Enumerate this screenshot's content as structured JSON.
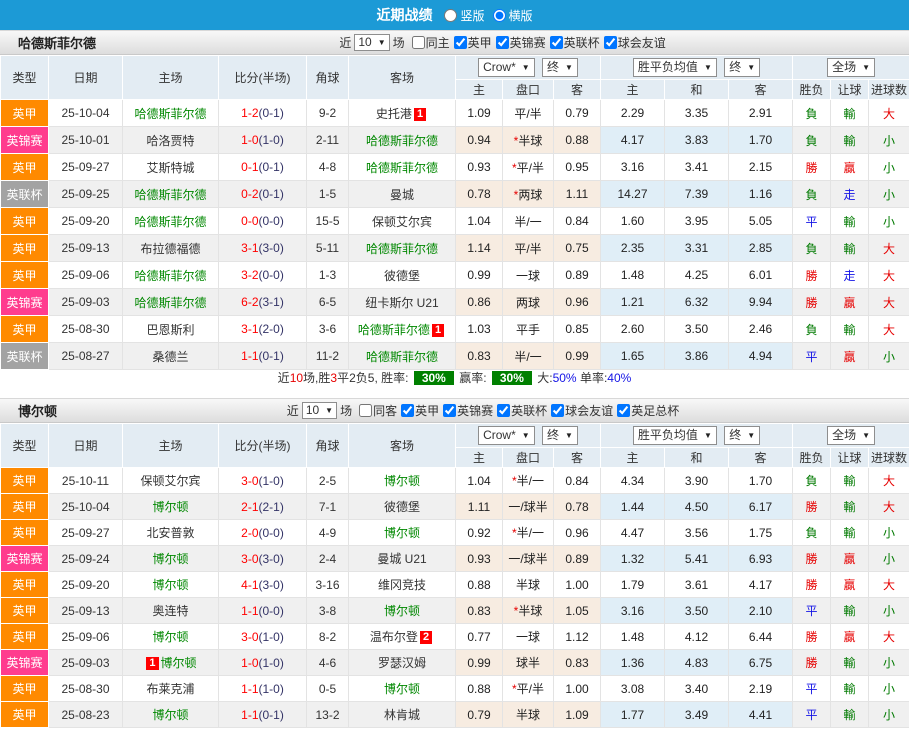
{
  "topbar": {
    "title": "近期战绩",
    "radios": [
      {
        "label": "竖版",
        "checked": false
      },
      {
        "label": "横版",
        "checked": true
      }
    ]
  },
  "columns": {
    "type": "类型",
    "date": "日期",
    "home": "主场",
    "score": "比分(半场)",
    "corner": "角球",
    "away": "客场",
    "odds_home": "主",
    "handicap": "盘口",
    "odds_away": "客",
    "avg_home": "主",
    "avg_draw": "和",
    "avg_away": "客",
    "outcome": "胜负",
    "letgoal": "让球",
    "goals": "进球数"
  },
  "dropdowns": {
    "bookmaker": "Crow*",
    "final_a": "终",
    "avg": "胜平负均值",
    "final_b": "终",
    "scope": "全场",
    "caret": "▼"
  },
  "colors": {
    "topbar_blue": "#1C9AD6",
    "league_yingjia": "#FF8A00",
    "league_yingjinsai": "#FF3C8E",
    "league_yinglianbei": "#A3A3A3",
    "subject_team_green": "#008800",
    "win_red": "#E60000",
    "draw_blue": "#1414E6",
    "loss_green": "#007A00",
    "rate_badge_green": "#008000",
    "score_red": "#FF0000"
  },
  "sections": [
    {
      "team": "哈德斯菲尔德",
      "filter": {
        "near": "近",
        "count": "10",
        "unit": "场",
        "checks": [
          {
            "label": "同主",
            "checked": false
          },
          {
            "label": "英甲",
            "checked": true
          },
          {
            "label": "英锦赛",
            "checked": true
          },
          {
            "label": "英联杯",
            "checked": true
          },
          {
            "label": "球会友谊",
            "checked": true
          }
        ]
      },
      "rows": [
        {
          "lg": "jia",
          "league": "英甲",
          "date": "25-10-04",
          "home": {
            "name": "哈德斯菲尔德",
            "green": true
          },
          "ft": "1-2",
          "ht": "(0-1)",
          "corner": "9-2",
          "away": {
            "name": "史托港",
            "badge": "1"
          },
          "o": [
            "1.09",
            "平/半",
            "0.79"
          ],
          "a": [
            "2.29",
            "3.35",
            "2.91"
          ],
          "r": [
            [
              "負",
              "g"
            ],
            [
              "輸",
              "g"
            ],
            [
              "大",
              "r"
            ]
          ]
        },
        {
          "lg": "jin",
          "league": "英锦赛",
          "date": "25-10-01",
          "home": {
            "name": "哈洛贾特"
          },
          "ft": "1-0",
          "ht": "(1-0)",
          "corner": "2-11",
          "away": {
            "name": "哈德斯菲尔德",
            "green": true
          },
          "o": [
            "0.94",
            "*半球",
            "0.88"
          ],
          "a": [
            "4.17",
            "3.83",
            "1.70"
          ],
          "r": [
            [
              "負",
              "g"
            ],
            [
              "輸",
              "g"
            ],
            [
              "小",
              "g"
            ]
          ]
        },
        {
          "lg": "jia",
          "league": "英甲",
          "date": "25-09-27",
          "home": {
            "name": "艾斯特城"
          },
          "ft": "0-1",
          "ht": "(0-1)",
          "corner": "4-8",
          "away": {
            "name": "哈德斯菲尔德",
            "green": true
          },
          "o": [
            "0.93",
            "*平/半",
            "0.95"
          ],
          "a": [
            "3.16",
            "3.41",
            "2.15"
          ],
          "r": [
            [
              "勝",
              "r"
            ],
            [
              "贏",
              "r"
            ],
            [
              "小",
              "g"
            ]
          ]
        },
        {
          "lg": "lian",
          "league": "英联杯",
          "date": "25-09-25",
          "home": {
            "name": "哈德斯菲尔德",
            "green": true
          },
          "ft": "0-2",
          "ht": "(0-1)",
          "corner": "1-5",
          "away": {
            "name": "曼城"
          },
          "o": [
            "0.78",
            "*两球",
            "1.11"
          ],
          "a": [
            "14.27",
            "7.39",
            "1.16"
          ],
          "r": [
            [
              "負",
              "g"
            ],
            [
              "走",
              "b"
            ],
            [
              "小",
              "g"
            ]
          ]
        },
        {
          "lg": "jia",
          "league": "英甲",
          "date": "25-09-20",
          "home": {
            "name": "哈德斯菲尔德",
            "green": true
          },
          "ft": "0-0",
          "ht": "(0-0)",
          "corner": "15-5",
          "away": {
            "name": "保顿艾尔宾"
          },
          "o": [
            "1.04",
            "半/一",
            "0.84"
          ],
          "a": [
            "1.60",
            "3.95",
            "5.05"
          ],
          "r": [
            [
              "平",
              "b"
            ],
            [
              "輸",
              "g"
            ],
            [
              "小",
              "g"
            ]
          ]
        },
        {
          "lg": "jia",
          "league": "英甲",
          "date": "25-09-13",
          "home": {
            "name": "布拉德福德"
          },
          "ft": "3-1",
          "ht": "(3-0)",
          "corner": "5-11",
          "away": {
            "name": "哈德斯菲尔德",
            "green": true
          },
          "o": [
            "1.14",
            "平/半",
            "0.75"
          ],
          "a": [
            "2.35",
            "3.31",
            "2.85"
          ],
          "r": [
            [
              "負",
              "g"
            ],
            [
              "輸",
              "g"
            ],
            [
              "大",
              "r"
            ]
          ]
        },
        {
          "lg": "jia",
          "league": "英甲",
          "date": "25-09-06",
          "home": {
            "name": "哈德斯菲尔德",
            "green": true
          },
          "ft": "3-2",
          "ht": "(0-0)",
          "corner": "1-3",
          "away": {
            "name": "彼德堡"
          },
          "o": [
            "0.99",
            "一球",
            "0.89"
          ],
          "a": [
            "1.48",
            "4.25",
            "6.01"
          ],
          "r": [
            [
              "勝",
              "r"
            ],
            [
              "走",
              "b"
            ],
            [
              "大",
              "r"
            ]
          ]
        },
        {
          "lg": "jin",
          "league": "英锦赛",
          "date": "25-09-03",
          "home": {
            "name": "哈德斯菲尔德",
            "green": true
          },
          "ft": "6-2",
          "ht": "(3-1)",
          "corner": "6-5",
          "away": {
            "name": "纽卡斯尔 U21"
          },
          "o": [
            "0.86",
            "两球",
            "0.96"
          ],
          "a": [
            "1.21",
            "6.32",
            "9.94"
          ],
          "r": [
            [
              "勝",
              "r"
            ],
            [
              "贏",
              "r"
            ],
            [
              "大",
              "r"
            ]
          ]
        },
        {
          "lg": "jia",
          "league": "英甲",
          "date": "25-08-30",
          "home": {
            "name": "巴恩斯利"
          },
          "ft": "3-1",
          "ht": "(2-0)",
          "corner": "3-6",
          "away": {
            "name": "哈德斯菲尔德",
            "green": true,
            "badge": "1"
          },
          "o": [
            "1.03",
            "平手",
            "0.85"
          ],
          "a": [
            "2.60",
            "3.50",
            "2.46"
          ],
          "r": [
            [
              "負",
              "g"
            ],
            [
              "輸",
              "g"
            ],
            [
              "大",
              "r"
            ]
          ]
        },
        {
          "lg": "lian",
          "league": "英联杯",
          "date": "25-08-27",
          "home": {
            "name": "桑德兰"
          },
          "ft": "1-1",
          "ht": "(0-1)",
          "corner": "11-2",
          "away": {
            "name": "哈德斯菲尔德",
            "green": true
          },
          "o": [
            "0.83",
            "半/一",
            "0.99"
          ],
          "a": [
            "1.65",
            "3.86",
            "4.94"
          ],
          "r": [
            [
              "平",
              "b"
            ],
            [
              "贏",
              "r"
            ],
            [
              "小",
              "g"
            ]
          ]
        }
      ],
      "summary": [
        {
          "t": "近"
        },
        {
          "t": "10",
          "c": "r"
        },
        {
          "t": "场,胜"
        },
        {
          "t": "3",
          "c": "r"
        },
        {
          "t": "平"
        },
        {
          "t": "2"
        },
        {
          "t": "负"
        },
        {
          "t": "5"
        },
        {
          "t": ", 胜率: "
        },
        {
          "t": "30%",
          "badge": true
        },
        {
          "t": " 赢率: "
        },
        {
          "t": "30%",
          "badge": true
        },
        {
          "t": " 大:"
        },
        {
          "t": "50%",
          "c": "b"
        },
        {
          "t": " 单率:"
        },
        {
          "t": "40%",
          "c": "b"
        }
      ]
    },
    {
      "team": "博尔顿",
      "filter": {
        "near": "近",
        "count": "10",
        "unit": "场",
        "checks": [
          {
            "label": "同客",
            "checked": false
          },
          {
            "label": "英甲",
            "checked": true
          },
          {
            "label": "英锦赛",
            "checked": true
          },
          {
            "label": "英联杯",
            "checked": true
          },
          {
            "label": "球会友谊",
            "checked": true
          },
          {
            "label": "英足总杯",
            "checked": true
          }
        ]
      },
      "rows": [
        {
          "lg": "jia",
          "league": "英甲",
          "date": "25-10-11",
          "home": {
            "name": "保顿艾尔宾"
          },
          "ft": "3-0",
          "ht": "(1-0)",
          "corner": "2-5",
          "away": {
            "name": "博尔顿",
            "green": true
          },
          "o": [
            "1.04",
            "*半/一",
            "0.84"
          ],
          "a": [
            "4.34",
            "3.90",
            "1.70"
          ],
          "r": [
            [
              "負",
              "g"
            ],
            [
              "輸",
              "g"
            ],
            [
              "大",
              "r"
            ]
          ]
        },
        {
          "lg": "jia",
          "league": "英甲",
          "date": "25-10-04",
          "home": {
            "name": "博尔顿",
            "green": true
          },
          "ft": "2-1",
          "ht": "(2-1)",
          "corner": "7-1",
          "away": {
            "name": "彼德堡"
          },
          "o": [
            "1.11",
            "一/球半",
            "0.78"
          ],
          "a": [
            "1.44",
            "4.50",
            "6.17"
          ],
          "r": [
            [
              "勝",
              "r"
            ],
            [
              "輸",
              "g"
            ],
            [
              "大",
              "r"
            ]
          ]
        },
        {
          "lg": "jia",
          "league": "英甲",
          "date": "25-09-27",
          "home": {
            "name": "北安普敦"
          },
          "ft": "2-0",
          "ht": "(0-0)",
          "corner": "4-9",
          "away": {
            "name": "博尔顿",
            "green": true
          },
          "o": [
            "0.92",
            "*半/一",
            "0.96"
          ],
          "a": [
            "4.47",
            "3.56",
            "1.75"
          ],
          "r": [
            [
              "負",
              "g"
            ],
            [
              "輸",
              "g"
            ],
            [
              "小",
              "g"
            ]
          ]
        },
        {
          "lg": "jin",
          "league": "英锦赛",
          "date": "25-09-24",
          "home": {
            "name": "博尔顿",
            "green": true
          },
          "ft": "3-0",
          "ht": "(3-0)",
          "corner": "2-4",
          "away": {
            "name": "曼城 U21"
          },
          "o": [
            "0.93",
            "一/球半",
            "0.89"
          ],
          "a": [
            "1.32",
            "5.41",
            "6.93"
          ],
          "r": [
            [
              "勝",
              "r"
            ],
            [
              "贏",
              "r"
            ],
            [
              "小",
              "g"
            ]
          ]
        },
        {
          "lg": "jia",
          "league": "英甲",
          "date": "25-09-20",
          "home": {
            "name": "博尔顿",
            "green": true
          },
          "ft": "4-1",
          "ht": "(3-0)",
          "corner": "3-16",
          "away": {
            "name": "维冈竞技"
          },
          "o": [
            "0.88",
            "半球",
            "1.00"
          ],
          "a": [
            "1.79",
            "3.61",
            "4.17"
          ],
          "r": [
            [
              "勝",
              "r"
            ],
            [
              "贏",
              "r"
            ],
            [
              "大",
              "r"
            ]
          ]
        },
        {
          "lg": "jia",
          "league": "英甲",
          "date": "25-09-13",
          "home": {
            "name": "奥连特"
          },
          "ft": "1-1",
          "ht": "(0-0)",
          "corner": "3-8",
          "away": {
            "name": "博尔顿",
            "green": true
          },
          "o": [
            "0.83",
            "*半球",
            "1.05"
          ],
          "a": [
            "3.16",
            "3.50",
            "2.10"
          ],
          "r": [
            [
              "平",
              "b"
            ],
            [
              "輸",
              "g"
            ],
            [
              "小",
              "g"
            ]
          ]
        },
        {
          "lg": "jia",
          "league": "英甲",
          "date": "25-09-06",
          "home": {
            "name": "博尔顿",
            "green": true
          },
          "ft": "3-0",
          "ht": "(1-0)",
          "corner": "8-2",
          "away": {
            "name": "温布尔登",
            "badge": "2"
          },
          "o": [
            "0.77",
            "一球",
            "1.12"
          ],
          "a": [
            "1.48",
            "4.12",
            "6.44"
          ],
          "r": [
            [
              "勝",
              "r"
            ],
            [
              "贏",
              "r"
            ],
            [
              "大",
              "r"
            ]
          ]
        },
        {
          "lg": "jin",
          "league": "英锦赛",
          "date": "25-09-03",
          "home": {
            "name": "博尔顿",
            "green": true,
            "badge": "1",
            "pos": "before"
          },
          "ft": "1-0",
          "ht": "(1-0)",
          "corner": "4-6",
          "away": {
            "name": "罗瑟汉姆"
          },
          "o": [
            "0.99",
            "球半",
            "0.83"
          ],
          "a": [
            "1.36",
            "4.83",
            "6.75"
          ],
          "r": [
            [
              "勝",
              "r"
            ],
            [
              "輸",
              "g"
            ],
            [
              "小",
              "g"
            ]
          ]
        },
        {
          "lg": "jia",
          "league": "英甲",
          "date": "25-08-30",
          "home": {
            "name": "布莱克浦"
          },
          "ft": "1-1",
          "ht": "(1-0)",
          "corner": "0-5",
          "away": {
            "name": "博尔顿",
            "green": true
          },
          "o": [
            "0.88",
            "*平/半",
            "1.00"
          ],
          "a": [
            "3.08",
            "3.40",
            "2.19"
          ],
          "r": [
            [
              "平",
              "b"
            ],
            [
              "輸",
              "g"
            ],
            [
              "小",
              "g"
            ]
          ]
        },
        {
          "lg": "jia",
          "league": "英甲",
          "date": "25-08-23",
          "home": {
            "name": "博尔顿",
            "green": true
          },
          "ft": "1-1",
          "ht": "(0-1)",
          "corner": "13-2",
          "away": {
            "name": "林肯城"
          },
          "o": [
            "0.79",
            "半球",
            "1.09"
          ],
          "a": [
            "1.77",
            "3.49",
            "4.41"
          ],
          "r": [
            [
              "平",
              "b"
            ],
            [
              "輸",
              "g"
            ],
            [
              "小",
              "g"
            ]
          ]
        }
      ]
    }
  ]
}
